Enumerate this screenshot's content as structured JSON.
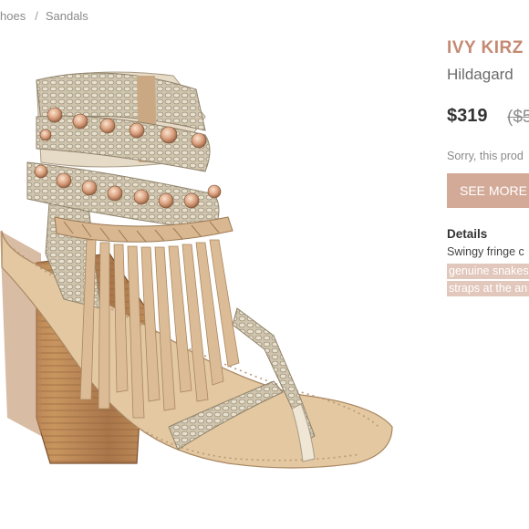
{
  "breadcrumb": {
    "items": [
      "hoes",
      "Sandals"
    ],
    "separator": "/"
  },
  "product": {
    "brand": "IVY KIRZ",
    "name": "Hildagard",
    "price": "$319",
    "original_price": "($5",
    "availability": "Sorry, this prod",
    "see_more_label": "SEE MORE",
    "details_title": "Details",
    "details_lines": [
      "Swingy fringe c",
      "genuine snakes",
      "straps at the an"
    ]
  },
  "colors": {
    "brand": "#c48a72",
    "button": "#d3aa98",
    "highlight": "#e2c7bc"
  },
  "image": {
    "description_icon": "sandal-product-image"
  }
}
